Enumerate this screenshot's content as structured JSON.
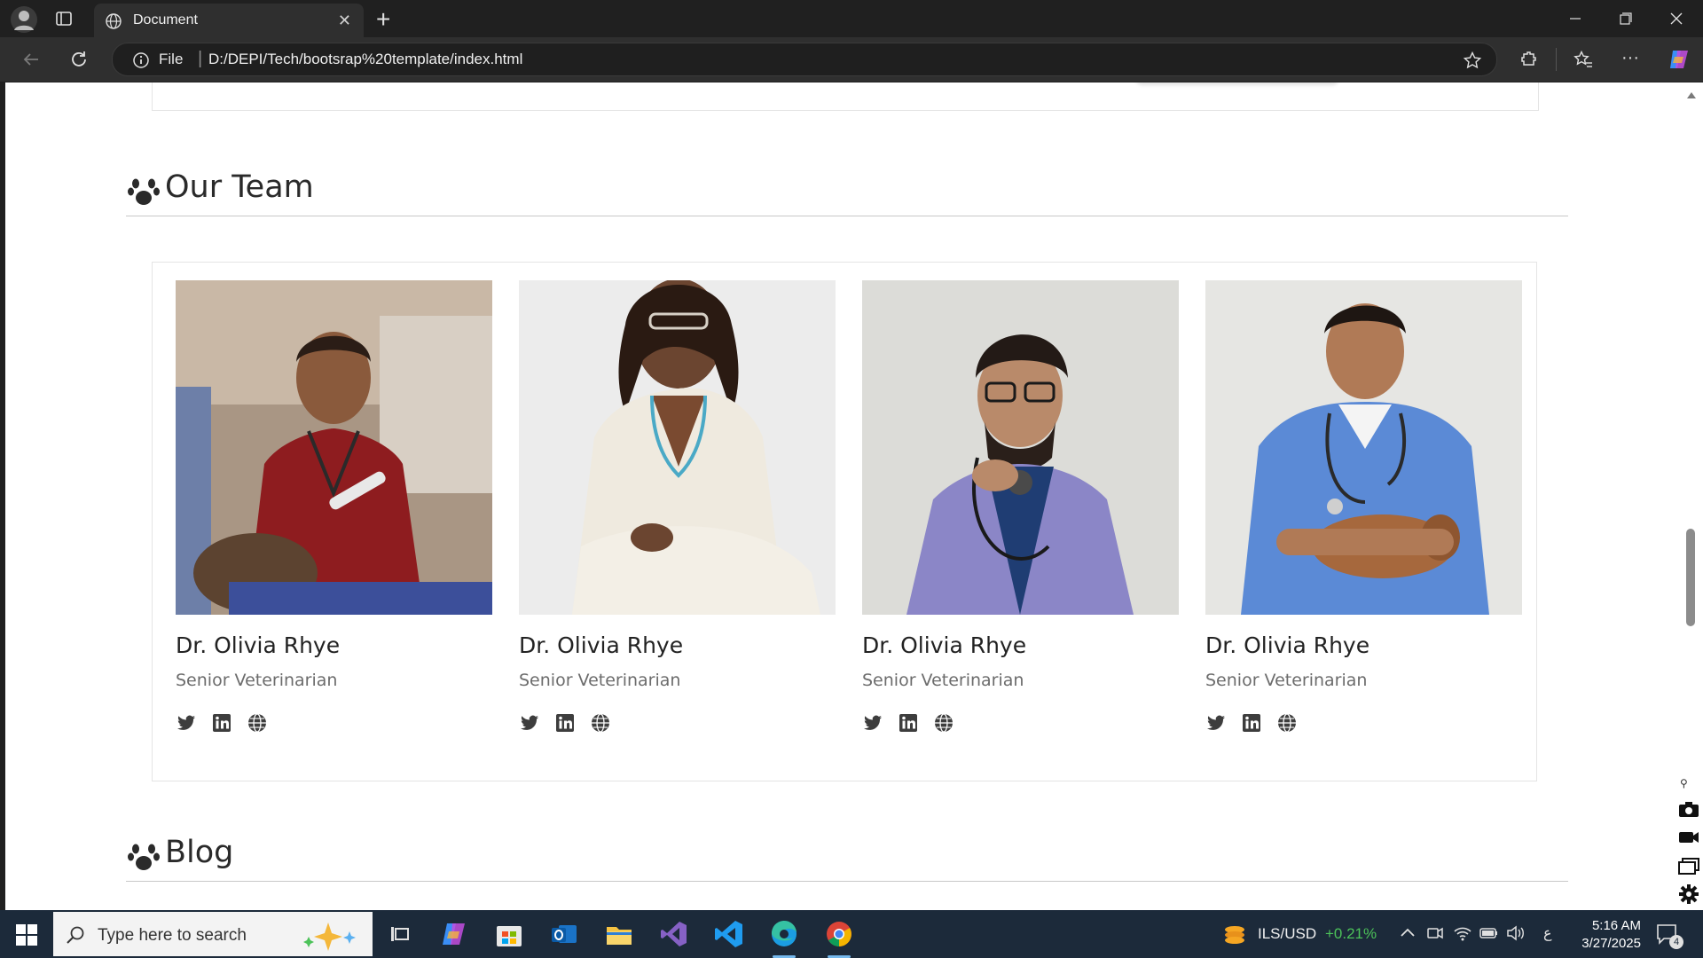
{
  "browser": {
    "tab_title": "Document",
    "url_scheme_label": "File",
    "url": "D:/DEPI/Tech/bootsrap%20template/index.html"
  },
  "sections": {
    "team_title": "Our Team",
    "blog_title": "Blog"
  },
  "team": [
    {
      "name": "Dr. Olivia Rhye",
      "role": "Senior Veterinarian"
    },
    {
      "name": "Dr. Olivia Rhye",
      "role": "Senior Veterinarian"
    },
    {
      "name": "Dr. Olivia Rhye",
      "role": "Senior Veterinarian"
    },
    {
      "name": "Dr. Olivia Rhye",
      "role": "Senior Veterinarian"
    }
  ],
  "social_icons": [
    "twitter-icon",
    "linkedin-icon",
    "globe-icon"
  ],
  "taskbar": {
    "search_placeholder": "Type here to search",
    "currency_label": "ILS/USD",
    "currency_change": "+0.21%",
    "time": "5:16 AM",
    "date": "3/27/2025",
    "notification_count": "4"
  },
  "colors": {
    "page_background": "#ffffff",
    "heading_text": "#2a2a2a",
    "role_text": "#6c6c6c",
    "icon_color": "#3d3d3d",
    "taskbar": "#1c2a3a"
  }
}
